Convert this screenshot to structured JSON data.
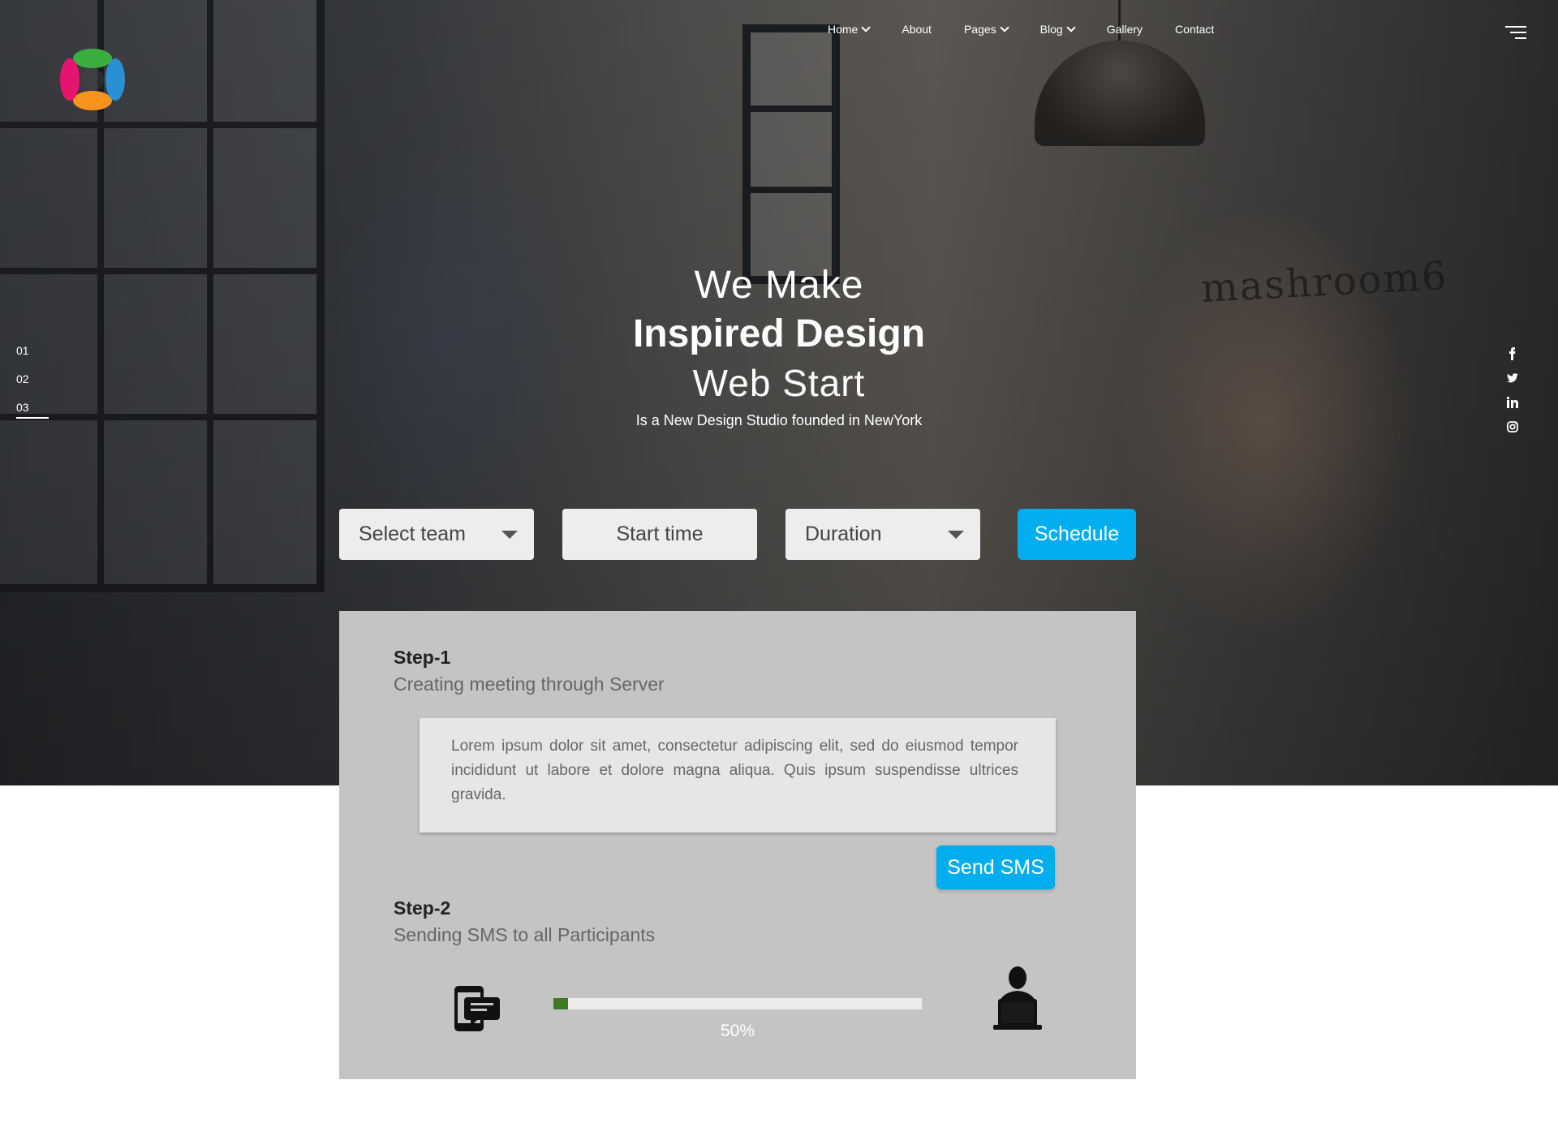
{
  "nav": {
    "items": [
      {
        "label": "Home",
        "has_dropdown": true
      },
      {
        "label": "About",
        "has_dropdown": false
      },
      {
        "label": "Pages",
        "has_dropdown": true
      },
      {
        "label": "Blog",
        "has_dropdown": true
      },
      {
        "label": "Gallery",
        "has_dropdown": false
      },
      {
        "label": "Contact",
        "has_dropdown": false
      }
    ]
  },
  "hero": {
    "line1": "We Make",
    "line2": "Inspired Design",
    "line3": "Web Start",
    "subtitle": "Is a New Design Studio founded in NewYork",
    "wall_text": "mashroom6"
  },
  "slides": [
    "01",
    "02",
    "03"
  ],
  "active_slide": "03",
  "social": [
    "facebook-icon",
    "twitter-icon",
    "linkedin-icon",
    "instagram-icon"
  ],
  "form": {
    "team_select": "Select team",
    "start_time": "Start time",
    "duration_select": "Duration",
    "schedule_label": "Schedule"
  },
  "steps": {
    "step1_title": "Step-1",
    "step1_desc": "Creating meeting through Server",
    "message": "Lorem ipsum dolor sit amet, consectetur adipiscing elit, sed do eiusmod tempor incididunt ut labore et dolore magna aliqua. Quis ipsum suspendisse ultrices gravida.",
    "send_sms_label": "Send SMS",
    "step2_title": "Step-2",
    "step2_desc": "Sending SMS to all Participants",
    "progress_label": "50%",
    "progress_fill_fraction": 0.04
  },
  "colors": {
    "accent": "#00aef0",
    "panel_bg": "#c4c4c4",
    "progress_fill": "#3d7a22"
  }
}
